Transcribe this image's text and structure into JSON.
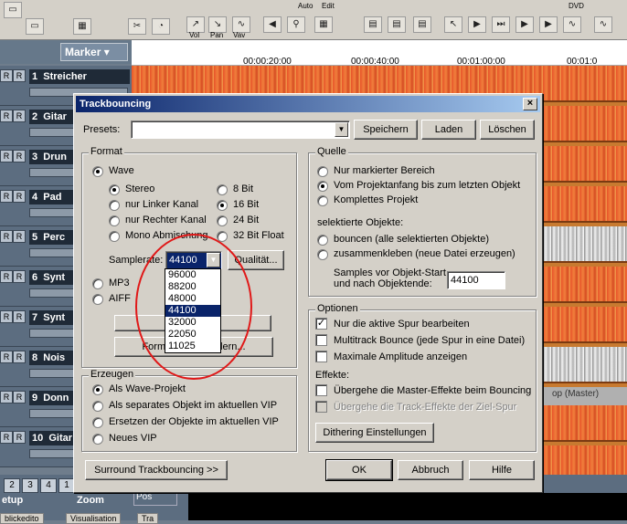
{
  "app": {
    "toolbar_captions": {
      "auto": "Auto",
      "edit": "Edit",
      "vol": "Vol",
      "pan": "Pan",
      "vav": "Vav",
      "dvd": "DVD"
    },
    "marker_label": "Marker",
    "ruler_ticks": [
      "00:00:20:00",
      "00:00:40:00",
      "00:01:00:00",
      "00:01:0"
    ],
    "tracks": [
      {
        "num": "1",
        "name": "Streicher"
      },
      {
        "num": "2",
        "name": "Gitar"
      },
      {
        "num": "3",
        "name": "Drun"
      },
      {
        "num": "4",
        "name": "Pad"
      },
      {
        "num": "5",
        "name": "Perc"
      },
      {
        "num": "6",
        "name": "Synt"
      },
      {
        "num": "7",
        "name": "Synt"
      },
      {
        "num": "8",
        "name": "Nois"
      },
      {
        "num": "9",
        "name": "Donn"
      },
      {
        "num": "10",
        "name": "Gitar"
      }
    ],
    "master_strip_text": "op (Master)",
    "bottom": {
      "numbers": [
        "2",
        "3",
        "4",
        "1"
      ],
      "setup_label": "etup",
      "zoom_label": "Zoom",
      "pos_label": "Pos",
      "tabs": [
        "blickedito",
        "Visualisation",
        "Tra"
      ]
    }
  },
  "dialog": {
    "title": "Trackbouncing",
    "close_glyph": "×",
    "presets_label": "Presets:",
    "presets_value": "",
    "buttons": {
      "save": "Speichern",
      "load": "Laden",
      "delete": "Löschen",
      "quality": "Qualität...",
      "format_details": "Formatdetails ändern...",
      "format_hidden": "",
      "dithering": "Dithering Einstellungen",
      "surround": "Surround Trackbouncing >>",
      "ok": "OK",
      "cancel": "Abbruch",
      "help": "Hilfe"
    },
    "format": {
      "label": "Format",
      "wave": "Wave",
      "stereo": "Stereo",
      "left": "nur Linker Kanal",
      "right": "nur Rechter Kanal",
      "mono": "Mono Abmischung",
      "bit8": "8 Bit",
      "bit16": "16 Bit",
      "bit24": "24 Bit",
      "bit32": "32 Bit Float",
      "samplerate_label": "Samplerate:",
      "samplerate_value": "44100",
      "mp3": "MP3",
      "aiff": "AIFF",
      "samplerate_options": [
        "96000",
        "88200",
        "48000",
        "44100",
        "32000",
        "22050",
        "11025"
      ],
      "samplerate_selected_index": 3
    },
    "quelle": {
      "label": "Quelle",
      "only_marked": "Nur markierter Bereich",
      "from_start": "Vom Projektanfang bis zum letzten Objekt",
      "complete": "Komplettes Projekt",
      "selected_label": "selektierte Objekte:",
      "bounce": "bouncen (alle selektierten Objekte)",
      "glue": "zusammenkleben (neue Datei erzeugen)",
      "samples_label_1": "Samples vor Objekt-Start",
      "samples_label_2": "und nach Objektende:",
      "samples_value": "44100"
    },
    "optionen": {
      "label": "Optionen",
      "only_active": "Nur die aktive Spur bearbeiten",
      "multitrack": "Multitrack Bounce (jede Spur in eine Datei)",
      "max_amp": "Maximale Amplitude anzeigen",
      "effects_label": "Effekte:",
      "skip_master": "Übergehe die Master-Effekte beim Bouncing",
      "skip_track": "Übergehe die Track-Effekte der Ziel-Spur"
    },
    "erzeugen": {
      "label": "Erzeugen",
      "as_wave": "Als Wave-Projekt",
      "as_object": "Als separates Objekt im aktuellen VIP",
      "replace": "Ersetzen der Objekte im aktuellen VIP",
      "new_vip": "Neues VIP"
    }
  }
}
